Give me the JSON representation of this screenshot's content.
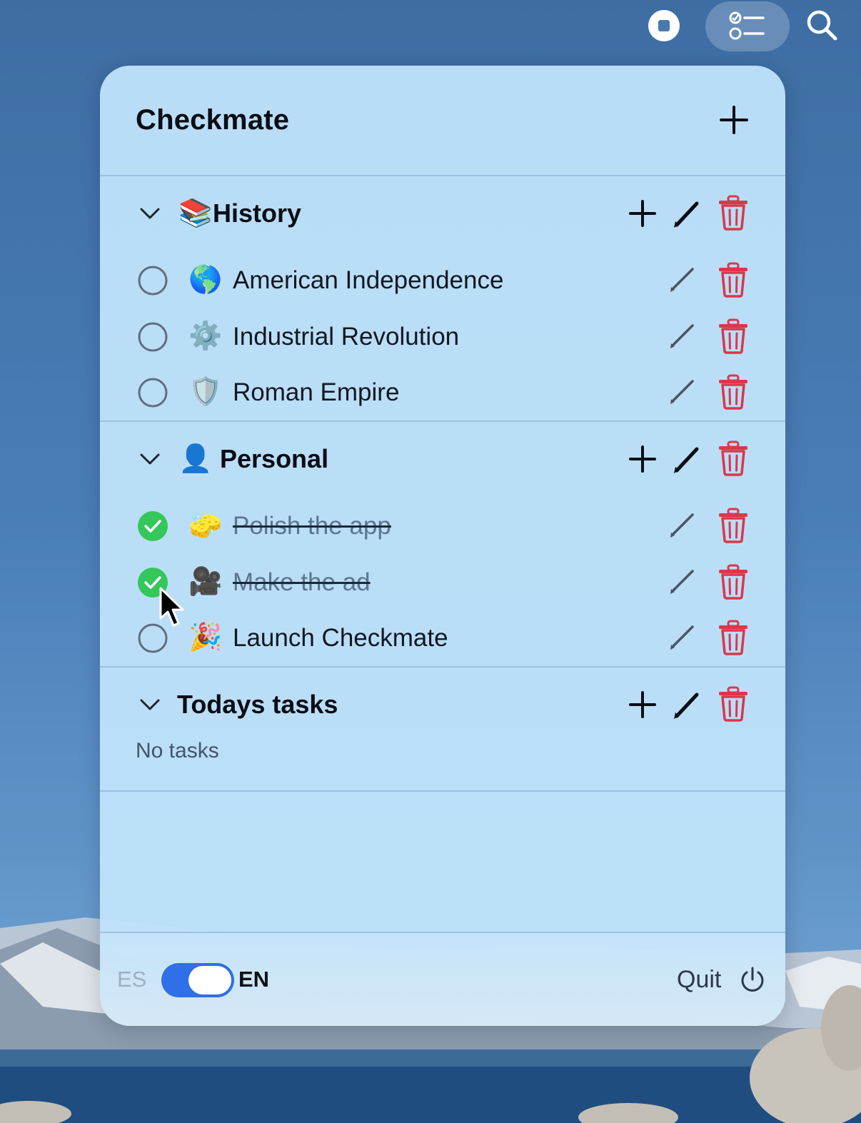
{
  "menubar": {
    "icons": [
      "stop-icon",
      "checklist-icon",
      "search-icon"
    ]
  },
  "app": {
    "title": "Checkmate"
  },
  "sections": [
    {
      "title": "History",
      "emoji": "📚",
      "tasks": [
        {
          "emoji": "🌎",
          "label": "American Independence",
          "done": false
        },
        {
          "emoji": "⚙️",
          "label": "Industrial Revolution",
          "done": false
        },
        {
          "emoji": "🛡️",
          "label": "Roman Empire",
          "done": false
        }
      ]
    },
    {
      "title": "Personal",
      "emoji": "👤",
      "tasks": [
        {
          "emoji": "🧽",
          "label": "Polish the app",
          "done": true
        },
        {
          "emoji": "🎥",
          "label": "Make the ad",
          "done": true
        },
        {
          "emoji": "🎉",
          "label": "Launch Checkmate",
          "done": false
        }
      ]
    },
    {
      "title": "Todays tasks",
      "emoji": "",
      "empty_text": "No tasks",
      "tasks": []
    }
  ],
  "footer": {
    "lang_off": "ES",
    "lang_on": "EN",
    "toggle_on": true,
    "quit_label": "Quit"
  },
  "colors": {
    "accent_blue": "#2f6fe8",
    "check_green": "#34c759",
    "trash_red": "#d9384a",
    "panel_bg": "#bfe2fa"
  }
}
